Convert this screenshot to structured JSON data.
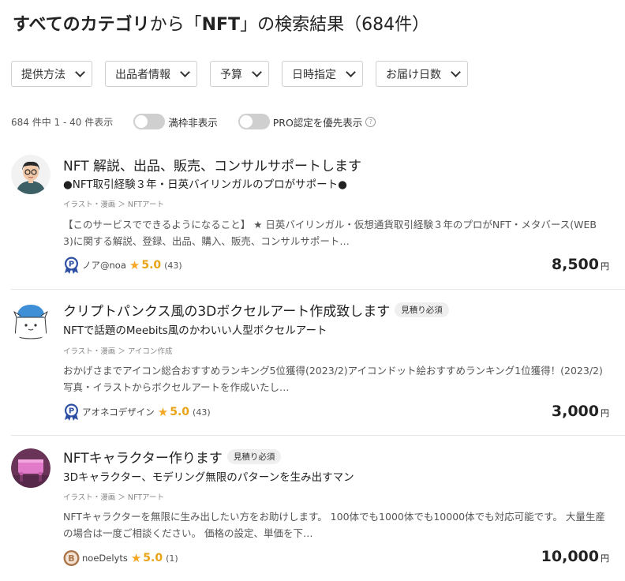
{
  "header": {
    "title_prefix": "すべてのカテゴリ",
    "title_middle": "から「",
    "title_query": "NFT",
    "title_suffix": "」の検索結果",
    "title_count": "（684件）"
  },
  "filters": [
    {
      "label": "提供方法"
    },
    {
      "label": "出品者情報"
    },
    {
      "label": "予算"
    },
    {
      "label": "日時指定"
    },
    {
      "label": "お届け日数"
    }
  ],
  "results_bar": {
    "count_text": "684 件中 1 - 40 件表示",
    "toggle_full_label": "満枠非表示",
    "toggle_pro_label": "PRO認定を優先表示"
  },
  "listings": [
    {
      "title": "NFT 解説、出品、販売、コンサルサポートします",
      "badge": "",
      "subtitle": "●NFT取引経験３年・日英バイリンガルのプロがサポート●",
      "breadcrumb": "イラスト・漫画 ＞ NFTアート",
      "description": "【このサービスでできるようになること】 ★ 日英バイリンガル・仮想通貨取引経験３年のプロがNFT・メタバース(WEB 3)に関する解説、登録、出品、購入、販売、コンサルサポート…",
      "seller": "ノア@noa",
      "medal": "P",
      "medal_color": "#2d4fa3",
      "rating": "5.0",
      "review_count": "(43)",
      "price": "8,500",
      "currency": "円"
    },
    {
      "title": "クリプトパンクス風の3Dボクセルアート作成致します",
      "badge": "見積り必須",
      "subtitle": "NFTで話題のMeebits風のかわいい人型ボクセルアート",
      "breadcrumb": "イラスト・漫画 ＞ アイコン作成",
      "description": "おかげさまでアイコン総合おすすめランキング5位獲得(2023/2)アイコンドット絵おすすめランキング1位獲得！(2023/2) 写真・イラストからボクセルアートを作成いたし…",
      "seller": "アオネコデザイン",
      "medal": "P",
      "medal_color": "#2d4fa3",
      "rating": "5.0",
      "review_count": "(43)",
      "price": "3,000",
      "currency": "円"
    },
    {
      "title": "NFTキャラクター作ります",
      "badge": "見積り必須",
      "subtitle": "3Dキャラクター、モデリング無限のパターンを生み出すマン",
      "breadcrumb": "イラスト・漫画 ＞ NFTアート",
      "description": "NFTキャラクターを無限に生み出したい方をお助けします。 100体でも1000体でも10000体でも対応可能です。 大量生産の場合は一度ご相談ください。 価格の設定、単価を下…",
      "seller": "noeDelyts",
      "medal": "B",
      "medal_color": "#a9754b",
      "rating": "5.0",
      "review_count": "(1)",
      "price": "10,000",
      "currency": "円"
    }
  ]
}
